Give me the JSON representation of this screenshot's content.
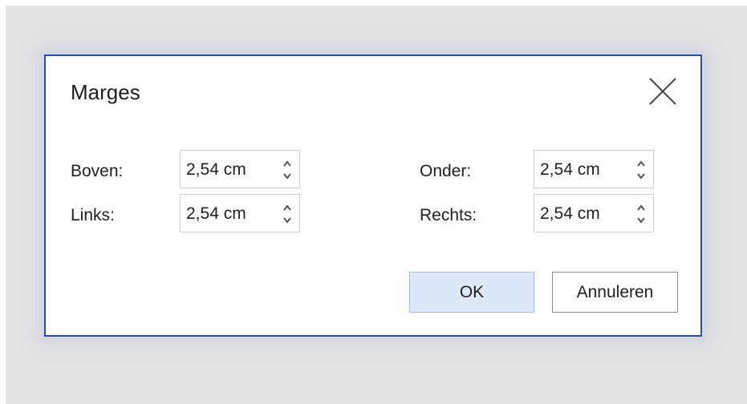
{
  "dialog": {
    "title": "Marges",
    "close_icon": "close-icon",
    "fields": {
      "top": {
        "label": "Boven:",
        "value": "2,54 cm"
      },
      "left": {
        "label": "Links:",
        "value": "2,54 cm"
      },
      "bottom": {
        "label": "Onder:",
        "value": "2,54 cm"
      },
      "right": {
        "label": "Rechts:",
        "value": "2,54 cm"
      }
    },
    "ok_label": "OK",
    "cancel_label": "Annuleren"
  },
  "colors": {
    "backdrop": "#e3e3e3",
    "dialog_border": "#2b4f9e",
    "ok_background": "#dde8f9",
    "ok_border": "#a3bde6",
    "text": "#1f1f1f"
  }
}
